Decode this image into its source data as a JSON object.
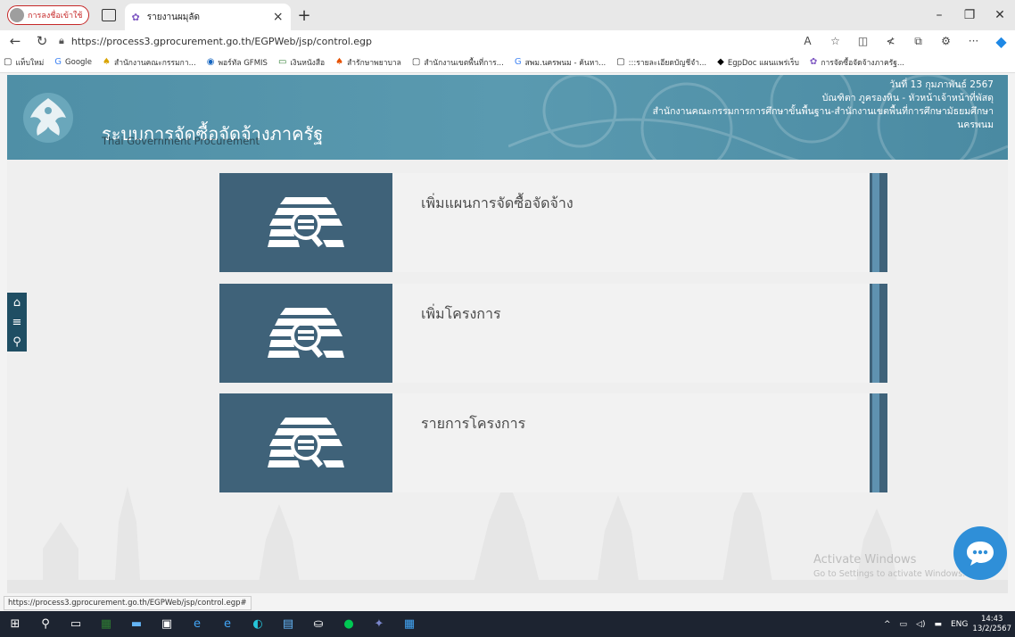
{
  "browser": {
    "profile_label": "การลงชื่อเข้าใช้",
    "tab_title": "รายงานผมุลัด",
    "url": "https://process3.gprocurement.go.th/EGPWeb/jsp/control.egp",
    "status_url": "https://process3.gprocurement.go.th/EGPWeb/jsp/control.egp#",
    "bookmarks": [
      "แท็บใหม่",
      "Google",
      "สำนักงานคณะกรรมกา...",
      "พอร์ทัล GFMIS",
      "เงินหนังสือ",
      "สำรักษาพยาบาล",
      "สำนักงานเขตพื้นที่การ...",
      "สพม.นครพนม - ค้นหา...",
      ":::รายละเอียดบัญชีจำ...",
      "EgpDoc แผนแพร่เร็บ",
      "การจัดซื้อจัดจ้างภาครัฐ..."
    ]
  },
  "header": {
    "title": "ระบบการจัดซื้อจัดจ้างภาครัฐ",
    "subtitle": "Thai Government Procurement",
    "date": "วันที่ 13 กุมภาพันธ์ 2567",
    "user": "บัณฑิตา ภูครองหิน - หัวหน้าเจ้าหน้าที่พัสดุ",
    "org_line1": "สำนักงานคณะกรรมการการศึกษาขั้นพื้นฐาน-สำนักงานเขตพื้นที่การศึกษามัธยมศึกษา",
    "org_line2": "นครพนม"
  },
  "menu": [
    {
      "label": "เพิ่มแผนการจัดซื้อจัดจ้าง",
      "icon": "document-search-icon"
    },
    {
      "label": "เพิ่มโครงการ",
      "icon": "document-search-icon"
    },
    {
      "label": "รายการโครงการ",
      "icon": "document-search-icon"
    }
  ],
  "watermark": {
    "line1": "Activate Windows",
    "line2": "Go to Settings to activate Windows."
  },
  "taskbar": {
    "lang": "ENG",
    "time": "14:43",
    "date": "13/2/2567"
  },
  "colors": {
    "header_bg": "#5a9ab0",
    "menu_icon_bg": "#3f6279",
    "sidebar_bg": "#1f4e63",
    "chat_button": "#2f8fd8"
  }
}
